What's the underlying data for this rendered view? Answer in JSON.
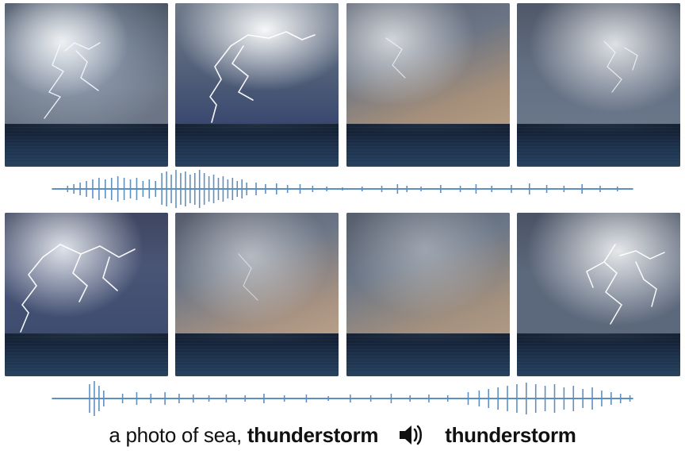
{
  "caption": {
    "prompt_prefix": "a photo of sea, ",
    "prompt_bold": "thunderstorm",
    "audio_label": "thunderstorm"
  },
  "rows": [
    {
      "frames": [
        "storm-sea-1",
        "storm-sea-2",
        "storm-sea-3",
        "storm-sea-4"
      ]
    },
    {
      "frames": [
        "storm-sea-5",
        "storm-sea-6",
        "storm-sea-7",
        "storm-sea-8"
      ]
    }
  ],
  "waveforms": [
    "thunder-waveform-row1",
    "thunder-waveform-row2"
  ],
  "icon": "speaker-icon",
  "colors": {
    "wave": "#5e8fbf"
  }
}
